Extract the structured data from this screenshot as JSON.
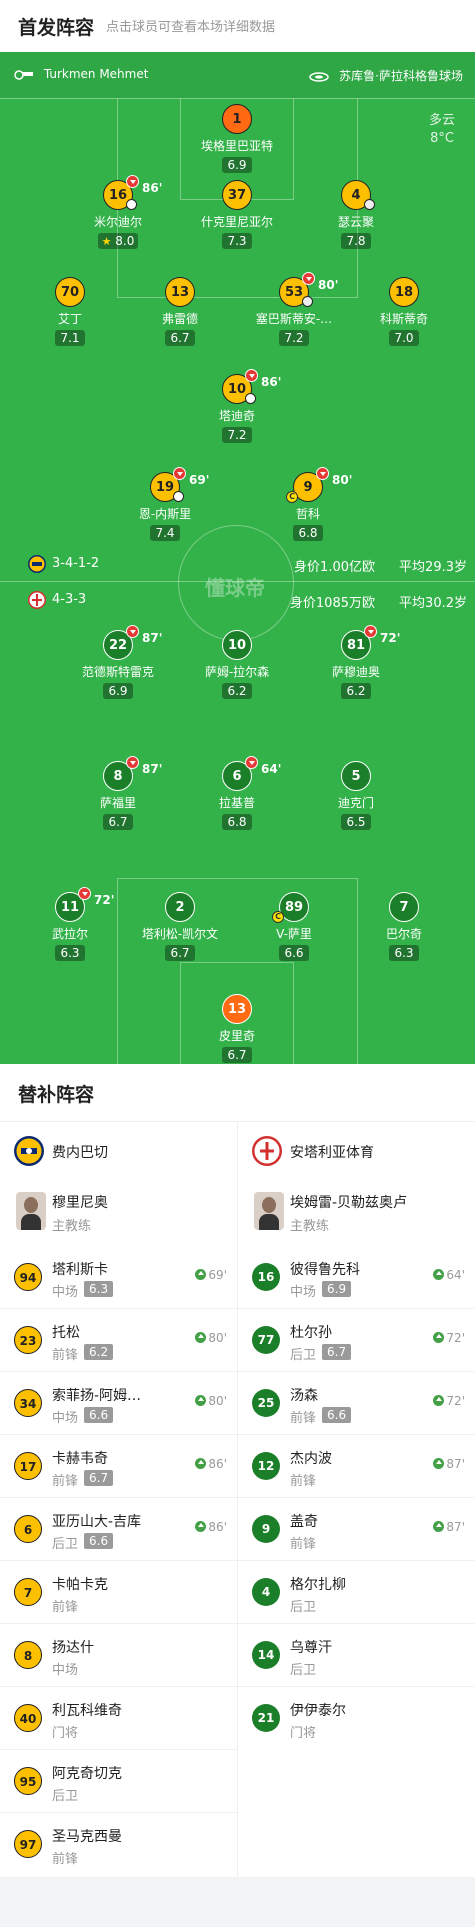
{
  "header": {
    "title": "首发阵容",
    "subtitle": "点击球员可查看本场详细数据"
  },
  "match": {
    "referee": "Turkmen Mehmet",
    "stadium": "苏库鲁·萨拉科格鲁球场",
    "weather": "多云",
    "temperature": "8°C",
    "watermark": "懂球帝"
  },
  "home": {
    "formation": "3-4-1-2",
    "value": "身价1.00亿欧",
    "age": "平均29.3岁",
    "color": "#fdc000",
    "players": [
      {
        "n": "1",
        "name": "埃格里巴亚特",
        "rating": "6.9"
      },
      {
        "n": "16",
        "name": "米尔迪尔",
        "rating": "8.0",
        "sub": "86'"
      },
      {
        "n": "37",
        "name": "什克里尼亚尔",
        "rating": "7.3"
      },
      {
        "n": "4",
        "name": "瑟云聚",
        "rating": "7.8"
      },
      {
        "n": "70",
        "name": "艾丁",
        "rating": "7.1"
      },
      {
        "n": "13",
        "name": "弗雷德",
        "rating": "6.7"
      },
      {
        "n": "53",
        "name": "塞巴斯蒂安-…",
        "rating": "7.2",
        "sub": "80'"
      },
      {
        "n": "18",
        "name": "科斯蒂奇",
        "rating": "7.0"
      },
      {
        "n": "10",
        "name": "塔迪奇",
        "rating": "7.2",
        "sub": "86'"
      },
      {
        "n": "19",
        "name": "恩-内斯里",
        "rating": "7.4",
        "sub": "69'"
      },
      {
        "n": "9",
        "name": "哲科",
        "rating": "6.8",
        "sub": "80'"
      }
    ]
  },
  "away": {
    "formation": "4-3-3",
    "value": "身价1085万欧",
    "age": "平均30.2岁",
    "color": "#1b7f2a",
    "players": [
      {
        "n": "22",
        "name": "范德斯特雷克",
        "rating": "6.9",
        "sub": "87'"
      },
      {
        "n": "10",
        "name": "萨姆-拉尔森",
        "rating": "6.2"
      },
      {
        "n": "81",
        "name": "萨穆迪奥",
        "rating": "6.2",
        "sub": "72'"
      },
      {
        "n": "8",
        "name": "萨福里",
        "rating": "6.7",
        "sub": "87'"
      },
      {
        "n": "6",
        "name": "拉基普",
        "rating": "6.8",
        "sub": "64'"
      },
      {
        "n": "5",
        "name": "迪克门",
        "rating": "6.5"
      },
      {
        "n": "11",
        "name": "武拉尔",
        "rating": "6.3",
        "sub": "72'"
      },
      {
        "n": "2",
        "name": "塔利松-凯尔文",
        "rating": "6.7"
      },
      {
        "n": "89",
        "name": "V-萨里",
        "rating": "6.6"
      },
      {
        "n": "7",
        "name": "巴尔奇",
        "rating": "6.3"
      },
      {
        "n": "13",
        "name": "皮里奇",
        "rating": "6.7"
      }
    ]
  },
  "subs": {
    "title": "替补阵容",
    "home_team": "费内巴切",
    "away_team": "安塔利亚体育",
    "home_coach": {
      "name": "穆里尼奥",
      "role": "主教练"
    },
    "away_coach": {
      "name": "埃姆雷-贝勒兹奥卢",
      "role": "主教练"
    },
    "home_list": [
      {
        "n": "94",
        "name": "塔利斯卡",
        "pos": "中场",
        "rating": "6.3",
        "in": "69'"
      },
      {
        "n": "23",
        "name": "托松",
        "pos": "前锋",
        "rating": "6.2",
        "in": "80'"
      },
      {
        "n": "34",
        "name": "索菲扬-阿姆…",
        "pos": "中场",
        "rating": "6.6",
        "in": "80'"
      },
      {
        "n": "17",
        "name": "卡赫韦奇",
        "pos": "前锋",
        "rating": "6.7",
        "in": "86'"
      },
      {
        "n": "6",
        "name": "亚历山大-吉库",
        "pos": "后卫",
        "rating": "6.6",
        "in": "86'"
      },
      {
        "n": "7",
        "name": "卡帕卡克",
        "pos": "前锋"
      },
      {
        "n": "8",
        "name": "扬达什",
        "pos": "中场"
      },
      {
        "n": "40",
        "name": "利瓦科维奇",
        "pos": "门将"
      },
      {
        "n": "95",
        "name": "阿克奇切克",
        "pos": "后卫"
      },
      {
        "n": "97",
        "name": "圣马克西曼",
        "pos": "前锋"
      }
    ],
    "away_list": [
      {
        "n": "16",
        "name": "彼得鲁先科",
        "pos": "中场",
        "rating": "6.9",
        "in": "64'"
      },
      {
        "n": "77",
        "name": "杜尔孙",
        "pos": "后卫",
        "rating": "6.7",
        "in": "72'"
      },
      {
        "n": "25",
        "name": "汤森",
        "pos": "前锋",
        "rating": "6.6",
        "in": "72'"
      },
      {
        "n": "12",
        "name": "杰内波",
        "pos": "前锋",
        "in": "87'"
      },
      {
        "n": "9",
        "name": "盖奇",
        "pos": "前锋",
        "in": "87'"
      },
      {
        "n": "4",
        "name": "格尔扎柳",
        "pos": "后卫"
      },
      {
        "n": "14",
        "name": "乌尊汗",
        "pos": "后卫"
      },
      {
        "n": "21",
        "name": "伊伊泰尔",
        "pos": "门将"
      }
    ]
  }
}
